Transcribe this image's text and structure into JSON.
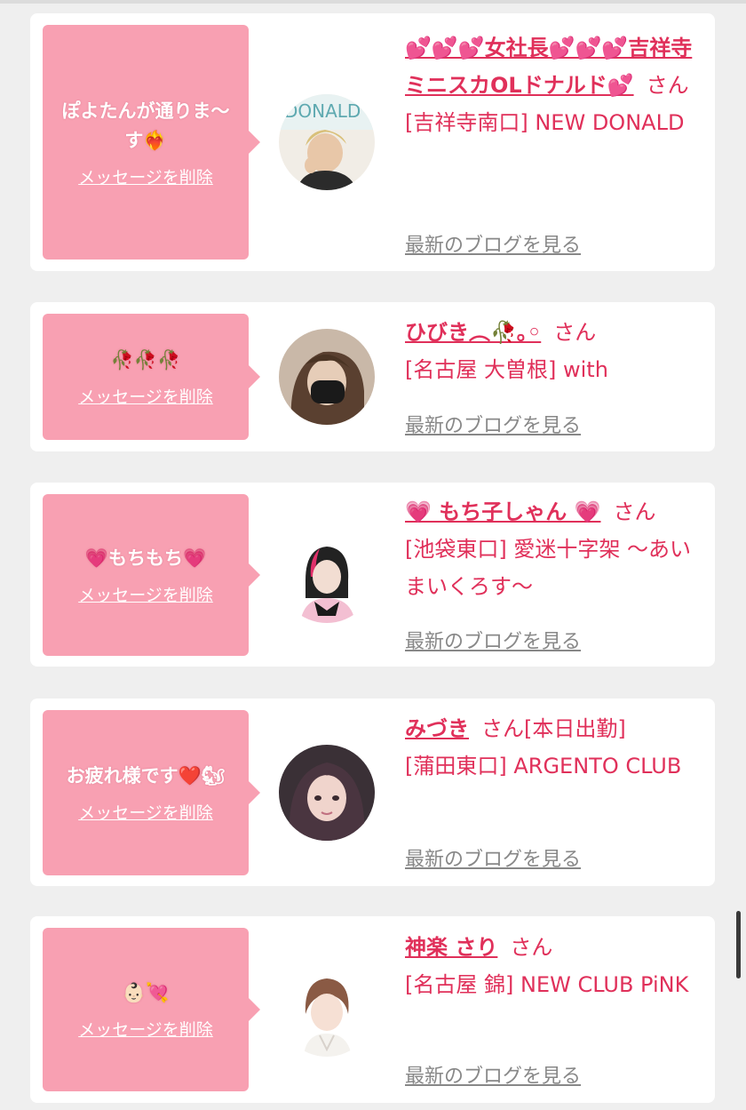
{
  "colors": {
    "accent_pink": "#e0305a",
    "bubble_pink": "#f8a0b2",
    "card_bg": "#ffffff",
    "page_bg": "#efefef",
    "link_gray": "#888888"
  },
  "common": {
    "delete_label": "メッセージを削除",
    "blog_label": "最新のブログを見る",
    "san_label": "さん"
  },
  "entries": [
    {
      "message": "ぽよたんが通りま〜す❤️‍🔥",
      "name": "💕💕💕女社長💕💕💕吉祥寺ミニスカOLドナルド💕",
      "name_suffix": "",
      "shop": "[吉祥寺南口] NEW DONALD",
      "avatar_text": "DONALD Kichijoji"
    },
    {
      "message": "🥀🥀🥀",
      "name": "ひびき︵🥀｡◦",
      "name_suffix": "",
      "shop": "[名古屋 大曽根] with",
      "avatar_text": ""
    },
    {
      "message": "💗もちもち💗",
      "name": "💗 もち子しゃん 💗",
      "name_suffix": "",
      "shop": "[池袋東口] 愛迷十字架 〜あいまいくろす〜",
      "avatar_text": ""
    },
    {
      "message": "お疲れ様です❤️🐿",
      "name": "みづき",
      "name_suffix": "[本日出勤]",
      "shop": "[蒲田東口] ARGENTO CLUB",
      "avatar_text": ""
    },
    {
      "message": "👶🏻💘",
      "name": "神楽 さり",
      "name_suffix": "",
      "shop": "[名古屋 錦] NEW CLUB PiNK",
      "avatar_text": ""
    }
  ]
}
